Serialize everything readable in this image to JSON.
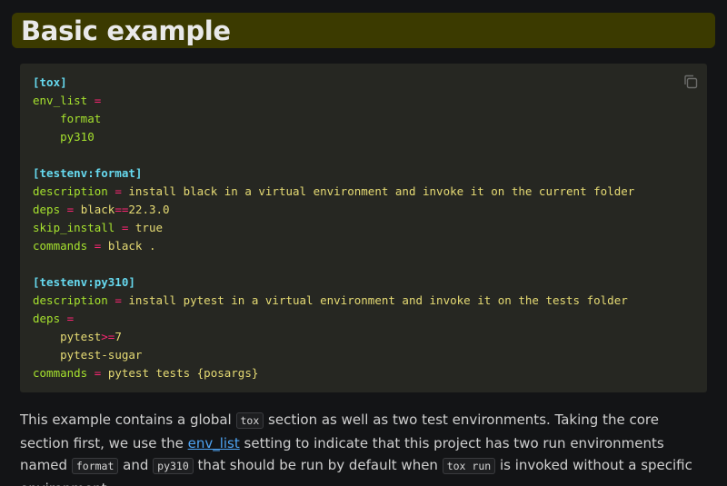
{
  "heading": "Basic example",
  "code": {
    "line1_section": "[tox]",
    "line2_key": "env_list",
    "line3_val": "format",
    "line4_val": "py310",
    "line6_section": "[testenv:format]",
    "line7_key": "description",
    "line7_val": "install black in a virtual environment and invoke it on the current folder",
    "line8_key": "deps",
    "line8_val_a": "black",
    "line8_op": "==",
    "line8_val_b": "22.3.0",
    "line9_key": "skip_install",
    "line9_val": "true",
    "line10_key": "commands",
    "line10_val": "black .",
    "line12_section": "[testenv:py310]",
    "line13_key": "description",
    "line13_val": "install pytest in a virtual environment and invoke it on the tests folder",
    "line14_key": "deps",
    "line15_val_a": "pytest",
    "line15_op": ">=",
    "line15_val_b": "7",
    "line16_val": "pytest-sugar",
    "line17_key": "commands",
    "line17_val": "pytest tests {posargs}",
    "equals": "="
  },
  "copy_icon": "copy-icon",
  "paragraph": {
    "t1": "This example contains a global ",
    "c1": "tox",
    "t2": " section as well as two test environments. Taking the core section first, we use the ",
    "link": "env_list",
    "t3": " setting to indicate that this project has two run environments named ",
    "c2": "format",
    "t4": " and ",
    "c3": "py310",
    "t5": " that should be run by default when ",
    "c4": "tox run",
    "t6": " is invoked without a specific environment."
  },
  "colors": {
    "heading_bg": "#3b3a00",
    "code_bg": "#262722",
    "section": "#66d9ef",
    "key": "#a6e22e",
    "operator": "#f92672",
    "string": "#e6db74",
    "link": "#4ea3f2"
  }
}
